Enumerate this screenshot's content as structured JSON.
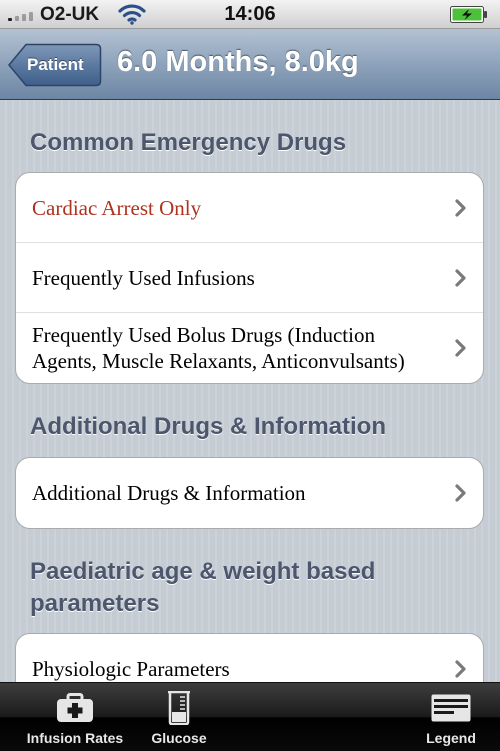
{
  "status_bar": {
    "carrier": "O2-UK",
    "time": "14:06"
  },
  "nav": {
    "back_label": "Patient",
    "title": "6.0 Months, 8.0kg"
  },
  "sections": [
    {
      "header": "Common Emergency Drugs",
      "items": [
        {
          "label": "Cardiac Arrest Only"
        },
        {
          "label": "Frequently Used Infusions"
        },
        {
          "label": "Frequently Used Bolus Drugs (Induction Agents, Muscle Relaxants, Anticonvulsants)"
        }
      ]
    },
    {
      "header": "Additional Drugs & Information",
      "items": [
        {
          "label": "Additional Drugs & Information"
        }
      ]
    },
    {
      "header": "Paediatric age & weight based parameters",
      "items": [
        {
          "label": "Physiologic Parameters"
        }
      ]
    }
  ],
  "tabs": [
    {
      "label": "Infusion Rates",
      "icon": "medical-kit-icon"
    },
    {
      "label": "Glucose",
      "icon": "beaker-icon"
    },
    {
      "label": "Legend",
      "icon": "legend-list-icon"
    }
  ],
  "colors": {
    "accent_red": "#b0321f",
    "section_header": "#4c566c"
  }
}
